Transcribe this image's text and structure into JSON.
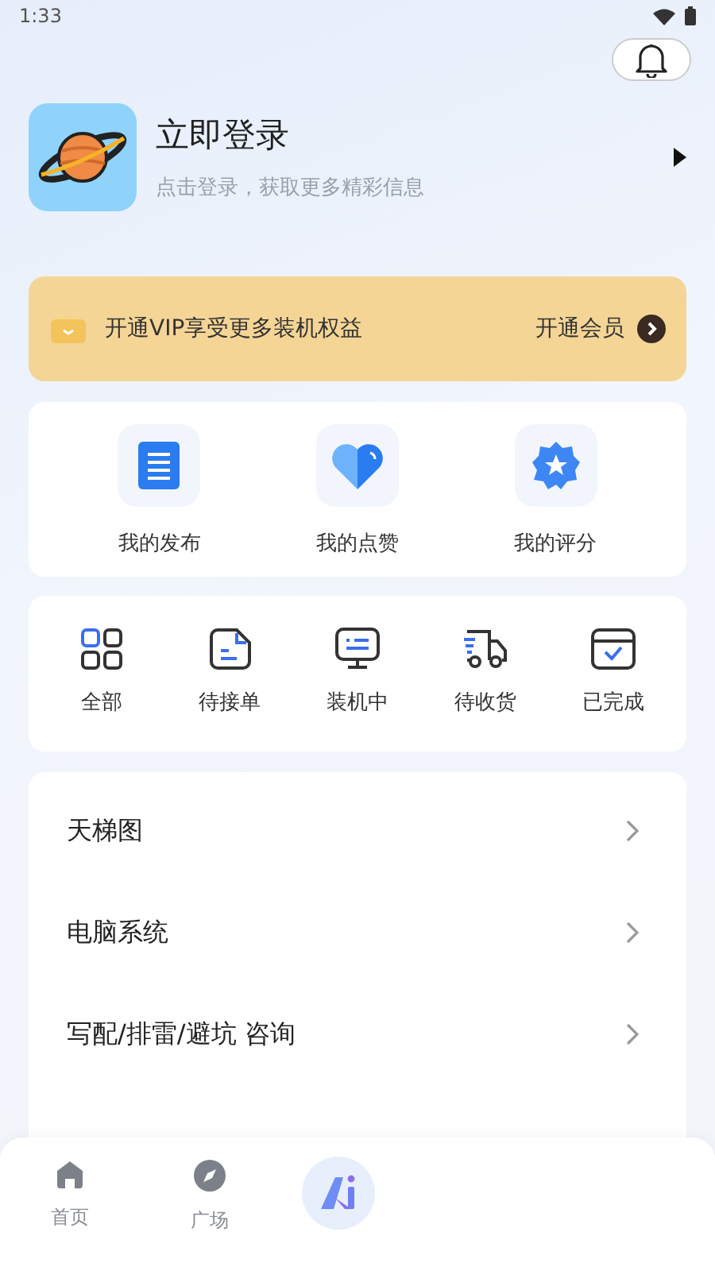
{
  "status_bar": {
    "time": "1:33"
  },
  "profile": {
    "title": "立即登录",
    "subtitle": "点击登录，获取更多精彩信息"
  },
  "vip_banner": {
    "text": "开通VIP享受更多装机权益",
    "action": "开通会员"
  },
  "my_actions": [
    {
      "label": "我的发布",
      "kind": "document"
    },
    {
      "label": "我的点赞",
      "kind": "heart"
    },
    {
      "label": "我的评分",
      "kind": "star"
    }
  ],
  "orders": [
    {
      "label": "全部",
      "kind": "grid"
    },
    {
      "label": "待接单",
      "kind": "note"
    },
    {
      "label": "装机中",
      "kind": "monitor"
    },
    {
      "label": "待收货",
      "kind": "truck"
    },
    {
      "label": "已完成",
      "kind": "done"
    }
  ],
  "menu": [
    {
      "label": "天梯图"
    },
    {
      "label": "电脑系统"
    },
    {
      "label": "写配/排雷/避坑 咨询"
    }
  ],
  "tab_bar": [
    {
      "label": "首页",
      "kind": "home",
      "selected": false
    },
    {
      "label": "广场",
      "kind": "compass",
      "selected": false
    },
    {
      "kind": "ai"
    }
  ]
}
